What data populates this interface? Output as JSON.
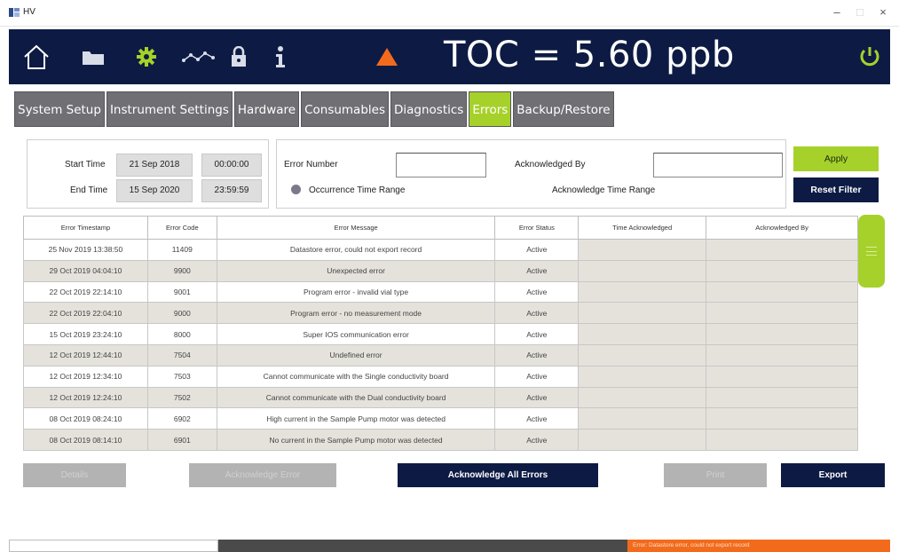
{
  "window": {
    "title": "HV"
  },
  "toolbar": {
    "icons": [
      "home-icon",
      "folder-icon",
      "gear-icon",
      "trend-icon",
      "lock-icon",
      "info-icon",
      "warning-icon",
      "power-icon"
    ],
    "toc_reading": "TOC = 5.60 ppb",
    "accent": "#a6d12a",
    "alert_color": "#f26b1d"
  },
  "tabs": [
    "System Setup",
    "Instrument Settings",
    "Hardware",
    "Consumables",
    "Diagnostics",
    "Errors",
    "Backup/Restore"
  ],
  "active_tab": "Errors",
  "filters": {
    "start_time_label": "Start Time",
    "start_date": "21 Sep 2018",
    "start_clock": "00:00:00",
    "end_time_label": "End Time",
    "end_date": "15 Sep 2020",
    "end_clock": "23:59:59",
    "error_number_label": "Error Number",
    "error_number_value": "",
    "acknowledged_by_label": "Acknowledged By",
    "acknowledged_by_value": "",
    "occurrence_range_label": "Occurrence Time Range",
    "acknowledge_range_label": "Acknowledge Time Range",
    "apply_label": "Apply",
    "reset_label": "Reset Filter"
  },
  "table": {
    "headers": [
      "Error Timestamp",
      "Error Code",
      "Error Message",
      "Error Status",
      "Time Acknowledged",
      "Acknowledged By"
    ],
    "rows": [
      [
        "25 Nov 2019 13:38:50",
        "11409",
        "Datastore error, could not export record",
        "Active",
        "",
        ""
      ],
      [
        "29 Oct 2019 04:04:10",
        "9900",
        "Unexpected error",
        "Active",
        "",
        ""
      ],
      [
        "22 Oct 2019 22:14:10",
        "9001",
        "Program error - invalid vial type",
        "Active",
        "",
        ""
      ],
      [
        "22 Oct 2019 22:04:10",
        "9000",
        "Program error - no measurement mode",
        "Active",
        "",
        ""
      ],
      [
        "15 Oct 2019 23:24:10",
        "8000",
        "Super IOS communication error",
        "Active",
        "",
        ""
      ],
      [
        "12 Oct 2019 12:44:10",
        "7504",
        "Undefined error",
        "Active",
        "",
        ""
      ],
      [
        "12 Oct 2019 12:34:10",
        "7503",
        "Cannot communicate with the Single conductivity board",
        "Active",
        "",
        ""
      ],
      [
        "12 Oct 2019 12:24:10",
        "7502",
        "Cannot communicate with the Dual conductivity board",
        "Active",
        "",
        ""
      ],
      [
        "08 Oct 2019 08:24:10",
        "6902",
        "High current in the Sample Pump motor was detected",
        "Active",
        "",
        ""
      ],
      [
        "08 Oct 2019 08:14:10",
        "6901",
        "No current in the Sample Pump motor was detected",
        "Active",
        "",
        ""
      ]
    ]
  },
  "actions": {
    "details_label": "Details",
    "acknowledge_error_label": "Acknowledge Error",
    "acknowledge_all_label": "Acknowledge All Errors",
    "print_label": "Print",
    "export_label": "Export"
  },
  "statusbar": {
    "error_message": "Error: Datastore error, could not export record"
  }
}
